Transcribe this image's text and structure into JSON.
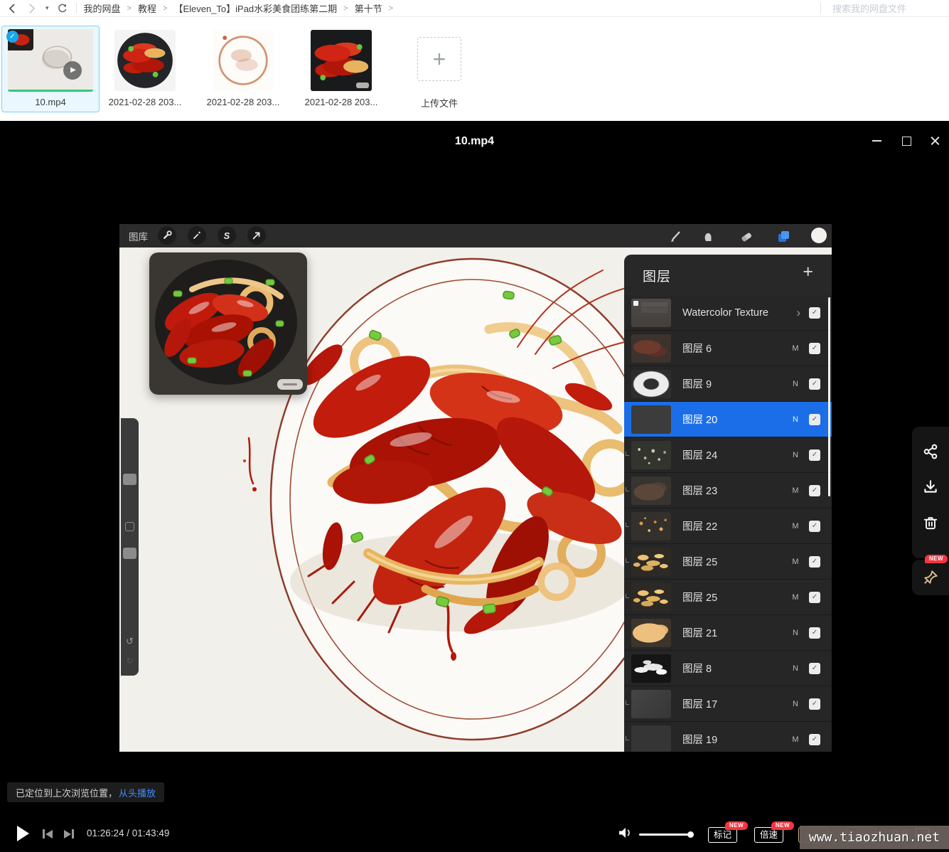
{
  "browser": {
    "breadcrumbs": [
      "我的网盘",
      "教程",
      "【Eleven_To】iPad水彩美食团练第二期",
      "第十节"
    ],
    "breadcrumb_separator": ">",
    "search_placeholder": "搜索我的网盘文件"
  },
  "files": {
    "items": [
      {
        "name": "10.mp4",
        "thumb": "video",
        "selected": true
      },
      {
        "name": "2021-02-28 203...",
        "thumb": "photo-plate",
        "selected": false
      },
      {
        "name": "2021-02-28 203...",
        "thumb": "sketch",
        "selected": false
      },
      {
        "name": "2021-02-28 203...",
        "thumb": "photo-full",
        "selected": false
      }
    ],
    "upload_label": "上传文件"
  },
  "player": {
    "title": "10.mp4",
    "toast": {
      "text": "已定位到上次浏览位置，",
      "action": "从头播放"
    },
    "time": "01:26:24 / 01:43:49",
    "controls": {
      "mark_label": "标记",
      "speed_label": "倍速",
      "new_badge": "NEW"
    },
    "watermark": "www.tiaozhuan.net"
  },
  "procreate": {
    "gallery_label": "图库",
    "selection_letter": "S",
    "layers_panel": {
      "title": "图层",
      "layers": [
        {
          "name": "Watercolor Texture",
          "blend": "",
          "thumb": "group",
          "group": true,
          "selected": false,
          "clip": false
        },
        {
          "name": "图层 6",
          "blend": "M",
          "thumb": "red6",
          "group": false,
          "selected": false,
          "clip": false
        },
        {
          "name": "图层 9",
          "blend": "N",
          "thumb": "ring9",
          "group": false,
          "selected": false,
          "clip": false
        },
        {
          "name": "图层 20",
          "blend": "N",
          "thumb": "plain20",
          "group": false,
          "selected": true,
          "clip": false
        },
        {
          "name": "图层 24",
          "blend": "N",
          "thumb": "speck24",
          "group": false,
          "selected": false,
          "clip": true
        },
        {
          "name": "图层 23",
          "blend": "M",
          "thumb": "smudge23",
          "group": false,
          "selected": false,
          "clip": true
        },
        {
          "name": "图层 22",
          "blend": "M",
          "thumb": "speck22",
          "group": false,
          "selected": false,
          "clip": true
        },
        {
          "name": "图层 25",
          "blend": "M",
          "thumb": "gold25",
          "group": false,
          "selected": false,
          "clip": true
        },
        {
          "name": "图层 25",
          "blend": "M",
          "thumb": "gold25",
          "group": false,
          "selected": false,
          "clip": true
        },
        {
          "name": "图层 21",
          "blend": "N",
          "thumb": "tan21",
          "group": false,
          "selected": false,
          "clip": false
        },
        {
          "name": "图层 8",
          "blend": "N",
          "thumb": "white8",
          "group": false,
          "selected": false,
          "clip": false
        },
        {
          "name": "图层 17",
          "blend": "N",
          "thumb": "plain17",
          "group": false,
          "selected": false,
          "clip": true
        },
        {
          "name": "图层 19",
          "blend": "M",
          "thumb": "plain19",
          "group": false,
          "selected": false,
          "clip": true
        }
      ]
    }
  },
  "icons": {
    "plus": "+",
    "check": "✓",
    "chevron": "›",
    "undo": "↺",
    "redo": "↻",
    "caret_down": "▾"
  },
  "colors": {
    "layer_selected_blue": "#1b6ee8",
    "file_selected_border": "#7fd1f8",
    "badge_red": "#f5353f",
    "toast_link_blue": "#3f8cff",
    "progress_green": "#2fc97e",
    "pin_gold": "#dcb88e"
  }
}
